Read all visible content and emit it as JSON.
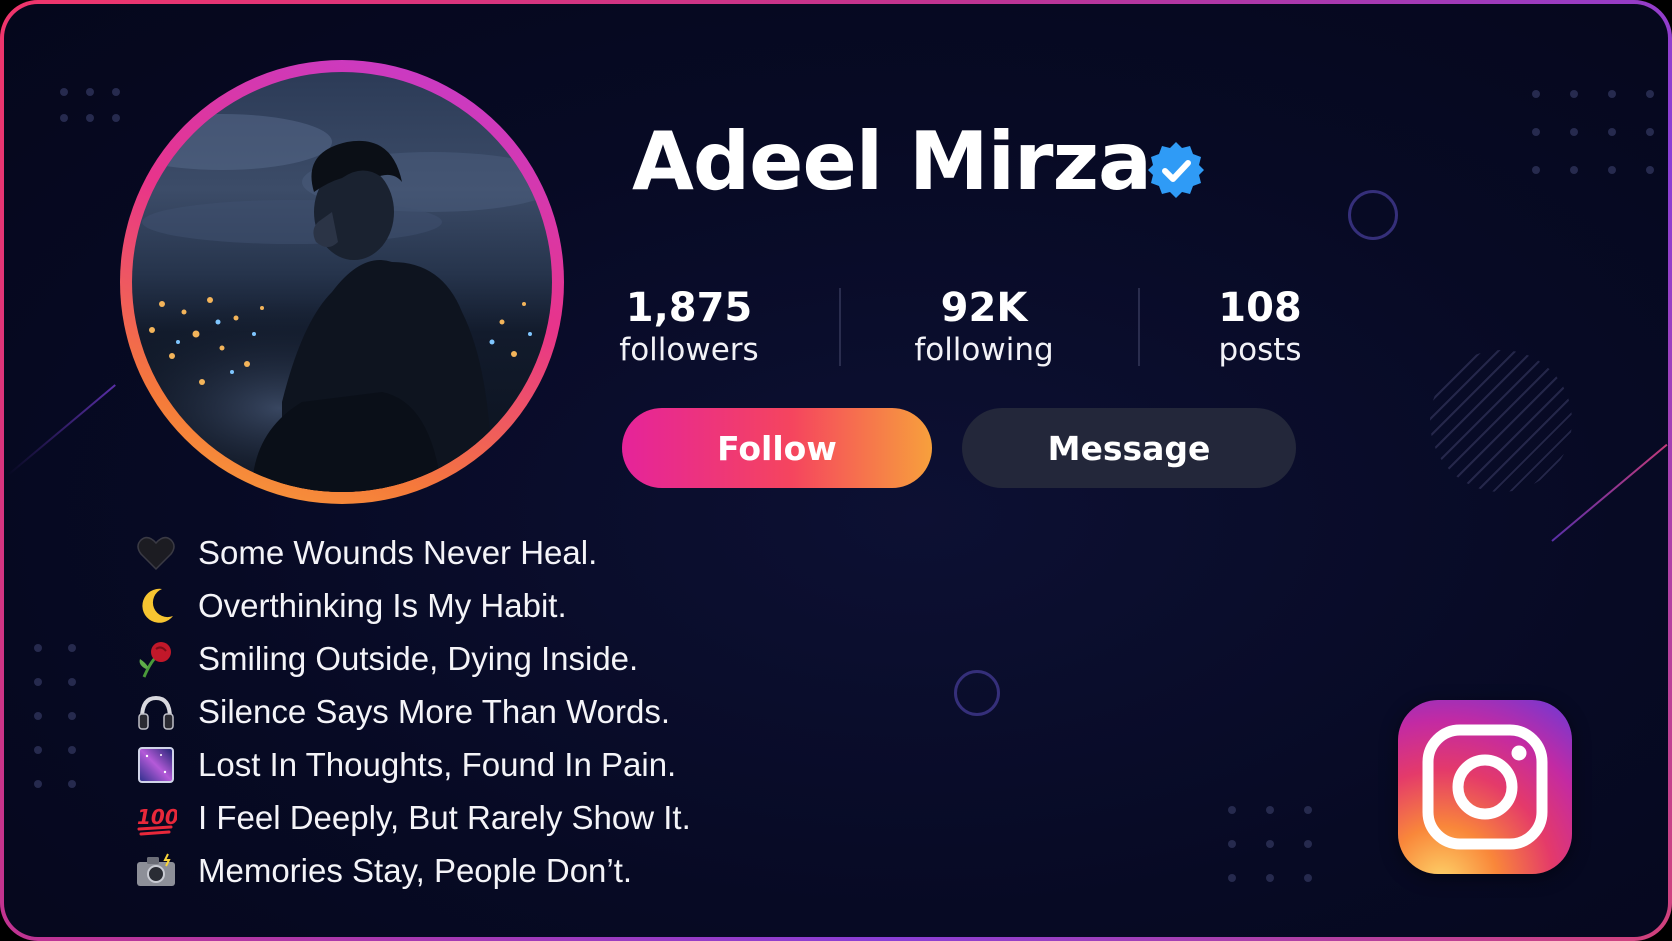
{
  "profile": {
    "name": "Adeel Mirza",
    "verified": true
  },
  "stats": [
    {
      "value": "1,875",
      "label": "followers"
    },
    {
      "value": "92K",
      "label": "following"
    },
    {
      "value": "108",
      "label": "posts"
    }
  ],
  "actions": {
    "follow_label": "Follow",
    "message_label": "Message"
  },
  "bio": [
    {
      "icon": "black-heart-icon",
      "text": "Some Wounds Never Heal."
    },
    {
      "icon": "crescent-moon-icon",
      "text": "Overthinking Is My Habit."
    },
    {
      "icon": "wilted-rose-icon",
      "text": "Smiling Outside, Dying Inside."
    },
    {
      "icon": "headphones-icon",
      "text": "Silence Says More Than Words."
    },
    {
      "icon": "milky-way-icon",
      "text": "Lost In Thoughts, Found In Pain."
    },
    {
      "icon": "hundred-points-icon",
      "text": "I Feel Deeply, But Rarely Show It."
    },
    {
      "icon": "camera-flash-icon",
      "text": "Memories Stay, People Don’t."
    }
  ],
  "colors": {
    "background": "#070a24",
    "follow_gradient": [
      "#e5239a",
      "#f5455e",
      "#f7a03c"
    ],
    "message_bg": "#23273a",
    "verified_badge": "#2f9bf6"
  },
  "icons": {
    "verified": "verified-badge-icon",
    "brand": "instagram-logo-icon"
  }
}
